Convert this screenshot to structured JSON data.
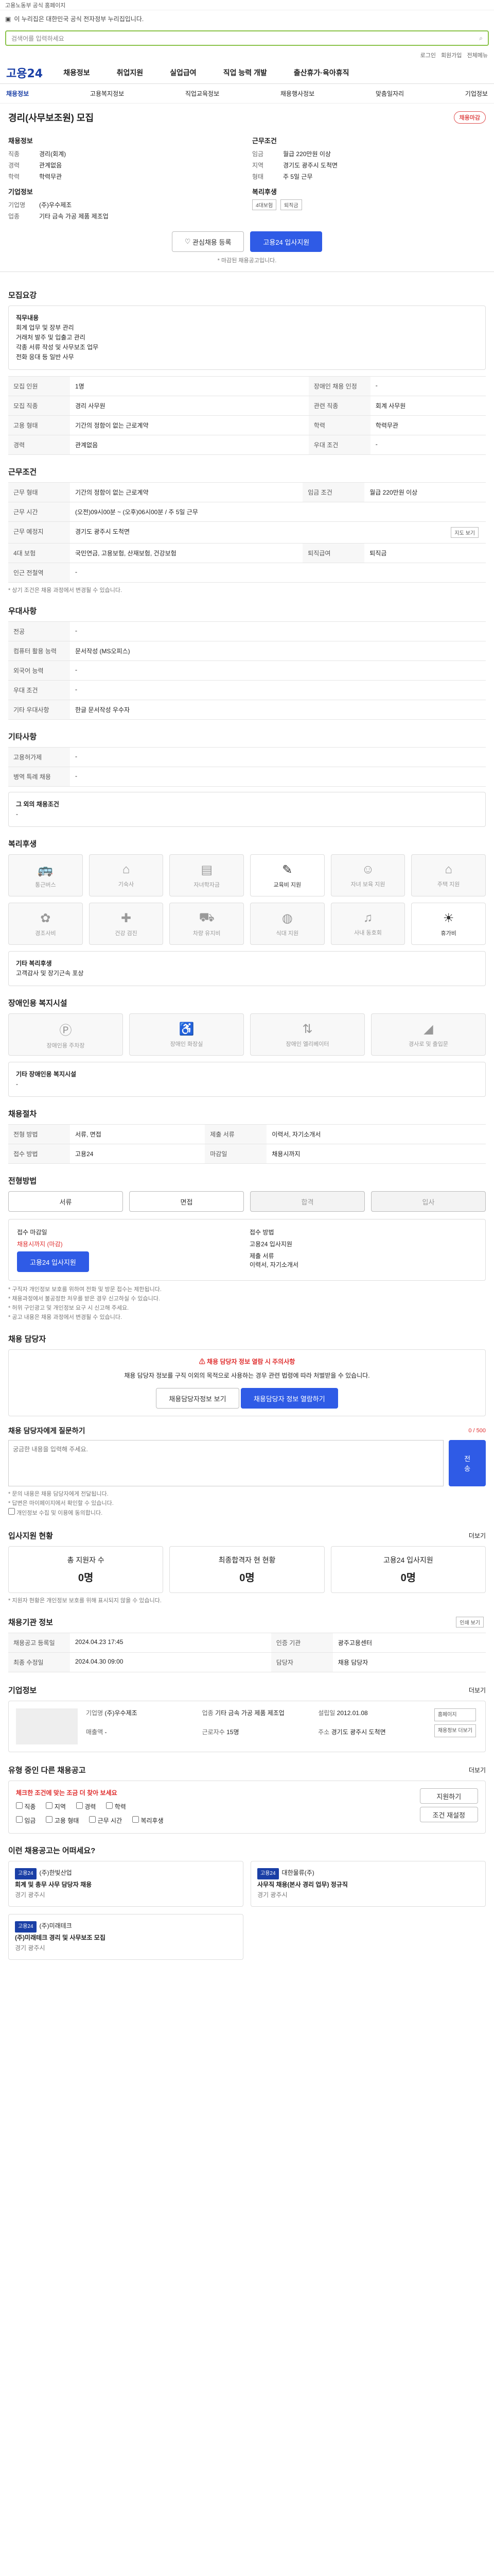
{
  "topbar": {
    "text": "고용노동부 공식 홈페이지"
  },
  "notice": {
    "text": "이 누리집은 대한민국 공식 전자정부 누리집입니다."
  },
  "search": {
    "placeholder": "검색어를 입력하세요"
  },
  "util": [
    "로그인",
    "회원가입",
    "전체메뉴"
  ],
  "gnb": {
    "logo": "고용24",
    "items": [
      "채용정보",
      "취업지원",
      "실업급여",
      "직업 능력 개발",
      "출산휴가·육아휴직"
    ]
  },
  "subnav": [
    "채용정보",
    "고용복지정보",
    "직업교육정보",
    "채용행사정보",
    "맞춤일자리",
    "기업정보"
  ],
  "job": {
    "title": "경리(사무보조원) 모집",
    "badge": "채용마감",
    "recruit_title": "채용정보",
    "recruit": [
      [
        "직종",
        "경리(회계)"
      ],
      [
        "경력",
        "관계없음"
      ],
      [
        "학력",
        "학력무관"
      ]
    ],
    "work_title": "근무조건",
    "work": [
      [
        "임금",
        "월급 220만원 이상"
      ],
      [
        "지역",
        "경기도 광주시 도척면"
      ],
      [
        "형태",
        "주 5일 근무"
      ]
    ],
    "company_title": "기업정보",
    "company": [
      [
        "기업명",
        "(주)우수제조"
      ],
      [
        "업종",
        "기타 금속 가공 제품 제조업"
      ]
    ],
    "benefit_title": "복리후생",
    "benefit_tags": [
      "4대보험",
      "퇴직금"
    ],
    "interest": "관심채용 등록",
    "apply": "고용24 입사지원",
    "notice_small": "* 마감된 채용공고입니다."
  },
  "detail": {
    "heading": "모집요강",
    "desc_title": "직무내용",
    "desc": [
      "회계 업무 및 장부 관리",
      "거래처 발주 및 입출고 관리",
      "각종 서류 작성 및 사무보조 업무",
      "전화 응대 등 일반 사무"
    ],
    "rows": [
      [
        "모집 인원",
        "1명"
      ],
      [
        "장애인 채용 인정",
        "-"
      ],
      [
        "모집 직종",
        "경리 사무원"
      ],
      [
        "관련 직종",
        "회계 사무원"
      ],
      [
        "고용 형태",
        "기간의 정함이 없는 근로계약"
      ],
      [
        "학력",
        "학력무관"
      ],
      [
        "경력",
        "관계없음"
      ],
      [
        "우대 조건",
        "-"
      ]
    ]
  },
  "cond": {
    "heading": "근무조건",
    "rows": [
      [
        "근무 형태",
        "기간의 정함이 없는 근로계약"
      ],
      [
        "임금 조건",
        "월급 220만원 이상"
      ],
      [
        "근무 시간",
        "(오전)09시00분 ~ (오후)06시00분 / 주 5일 근무"
      ],
      [
        "근무 예정지",
        "경기도 광주시 도척면"
      ],
      [
        "4대 보험",
        "국민연금, 고용보험, 산재보험, 건강보험"
      ],
      [
        "퇴직급여",
        "퇴직금"
      ],
      [
        "인근 전철역",
        "-"
      ]
    ],
    "map_btn": "지도 보기",
    "note": "* 상기 조건은 채용 과정에서 변경될 수 있습니다."
  },
  "prefer": {
    "heading": "우대사항",
    "rows": [
      [
        "전공",
        "-"
      ],
      [
        "컴퓨터 활용 능력",
        "문서작성 (MS오피스)"
      ],
      [
        "외국어 능력",
        "-"
      ],
      [
        "우대 조건",
        "-"
      ],
      [
        "기타 우대사항",
        "한글 문서작성 우수자"
      ]
    ]
  },
  "other": {
    "heading": "기타사항",
    "rows": [
      [
        "고용허가제",
        "-"
      ],
      [
        "병역 특례 채용",
        "-"
      ]
    ],
    "extra_title": "그 외의 채용조건",
    "extra": "-"
  },
  "welfare": {
    "heading": "복리후생",
    "cards": [
      "통근버스",
      "기숙사",
      "자녀학자금",
      "교육비 지원",
      "자녀 보육 지원",
      "주택 지원",
      "경조사비",
      "건강 검진",
      "차량 유지비",
      "식대 지원",
      "사내 동호회",
      "휴가비"
    ],
    "on_index": [
      3,
      11
    ],
    "other_title": "기타 복리후생",
    "other": "고객감사 및 장기근속 포상"
  },
  "disabled": {
    "heading": "장애인용 복지시설",
    "cards": [
      "장애인용 주차장",
      "장애인 화장실",
      "장애인 엘리베이터",
      "경사로 및 출입문"
    ],
    "other_title": "기타 장애인용 복지시설",
    "other": "-"
  },
  "process": {
    "heading": "채용절차",
    "rows": [
      [
        "전형 방법",
        "서류, 면접"
      ],
      [
        "제출 서류",
        "이력서, 자기소개서"
      ],
      [
        "접수 방법",
        "고용24"
      ],
      [
        "마감일",
        "채용시까지"
      ]
    ]
  },
  "apply": {
    "heading": "전형방법",
    "steps": [
      "서류",
      "면접",
      "합격",
      "입사"
    ],
    "left_title": "접수 마감일",
    "left_val": "채용시까지",
    "left_red": "채용시까지 (마감)",
    "btn": "고용24 입사지원",
    "right_title": "접수 방법",
    "right_val": "고용24 입사지원",
    "right_title2": "제출 서류",
    "right_val2": "이력서, 자기소개서",
    "notes": [
      "* 구직자 개인정보 보호를 위하여 전화 및 방문 접수는 제한됩니다.",
      "* 채용과정에서 불공정한 처우를 받은 경우 신고하실 수 있습니다.",
      "* 허위 구인광고 및 개인정보 요구 시 신고해 주세요.",
      "* 공고 내용은 채용 과정에서 변경될 수 있습니다."
    ]
  },
  "contact": {
    "heading": "채용 담당자",
    "warn": "채용 담당자 정보 열람 시 주의사항",
    "warn_text": "채용 담당자 정보를 구직 이외의 목적으로 사용하는 경우 관련 법령에 따라 처벌받을 수 있습니다.",
    "btn1": "채용담당자정보 보기",
    "btn2": "채용담당자 정보 열람하기"
  },
  "inquiry": {
    "heading": "채용 담당자에게 질문하기",
    "counter": "0 / 500",
    "placeholder": "궁금한 내용을 입력해 주세요.",
    "submit": "전송",
    "agree": "개인정보 수집 및 이용에 동의합니다.",
    "notes": [
      "* 문의 내용은 채용 담당자에게 전달됩니다.",
      "* 답변은 마이페이지에서 확인할 수 있습니다."
    ]
  },
  "stats": {
    "heading": "입사지원 현황",
    "more": "더보기",
    "items": [
      [
        "총 지원자 수",
        "0명"
      ],
      [
        "최종합격자 현 현황",
        "0명"
      ],
      [
        "고용24 입사지원",
        "0명"
      ]
    ],
    "note": "* 지원자 현황은 개인정보 보호를 위해 표시되지 않을 수 있습니다."
  },
  "info": {
    "heading": "채용기관 정보",
    "rows": [
      [
        "채용공고 등록일",
        "2024.04.23 17:45"
      ],
      [
        "인증 기관",
        "광주고용센터"
      ],
      [
        "최종 수정일",
        "2024.04.30 09:00"
      ],
      [
        "담당자",
        "채용 담당자"
      ]
    ],
    "btn": "인쇄 보기"
  },
  "biz": {
    "heading": "기업정보",
    "more": "더보기",
    "rows": [
      [
        "기업명",
        "(주)우수제조"
      ],
      [
        "업종",
        "기타 금속 가공 제품 제조업"
      ],
      [
        "설립일",
        "2012.01.08"
      ],
      [
        "매출액",
        "-"
      ],
      [
        "근로자수",
        "15명"
      ],
      [
        "주소",
        "경기도 광주시 도척면"
      ]
    ],
    "btn1": "홈페이지",
    "btn2": "채용정보 더보기"
  },
  "similar": {
    "heading": "유형 중인 다른 채용공고",
    "more": "더보기",
    "title": "체크한 조건에 맞는 조금 더 찾아 보세요",
    "conditions": [
      "직종",
      "지역",
      "경력",
      "학력"
    ],
    "options": [
      "임금",
      "고용 형태",
      "근무 시간",
      "복리후생"
    ],
    "btn1": "지원하기",
    "btn2": "조건 재설정"
  },
  "reco": {
    "heading": "이런 채용공고는 어떠세요?",
    "items": [
      {
        "tag": "고용24",
        "company": "(주)한빛산업",
        "title": "회계 및 총무 사무 담당자 채용",
        "loc": "경기 광주시"
      },
      {
        "tag": "고용24",
        "company": "대한물류(주)",
        "title": "사무직 채용(본사 경리 업무) 정규직",
        "loc": "경기 광주시"
      },
      {
        "tag": "고용24",
        "company": "(주)미래테크",
        "title": "(주)미래테크 경리 및 사무보조 모집",
        "loc": "경기 광주시"
      }
    ]
  }
}
